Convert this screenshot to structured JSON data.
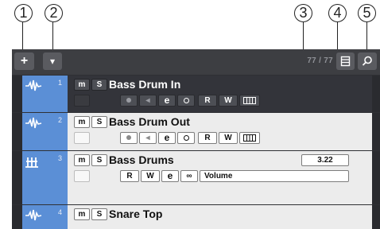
{
  "callouts": [
    "1",
    "2",
    "3",
    "4",
    "5"
  ],
  "toolbar": {
    "add_button": "+",
    "add_menu_button": "▾",
    "track_count": "77 / 77"
  },
  "icons": {
    "add_button": "plus-icon",
    "menu_button": "caret-down-icon",
    "visibility_button": "list-icon",
    "find_button": "search-icon",
    "audio_track": "audio-waveform-icon",
    "group_track": "group-folder-icon"
  },
  "colors": {
    "track_color": "#5b8fd6",
    "selected_row": "#33343a",
    "panel": "#2f3034"
  },
  "tracks": [
    {
      "number": "1",
      "name": "Bass Drum In",
      "selected": true,
      "mute": "m",
      "solo": "S",
      "read": "R",
      "write": "W"
    },
    {
      "number": "2",
      "name": "Bass Drum Out",
      "selected": false,
      "mute": "m",
      "solo": "S",
      "read": "R",
      "write": "W"
    },
    {
      "number": "3",
      "name": "Bass Drums",
      "selected": false,
      "mute": "m",
      "solo": "S",
      "read": "R",
      "write": "W",
      "value": "3.22",
      "parameter": "Volume"
    },
    {
      "number": "4",
      "name": "Snare Top",
      "selected": false,
      "mute": "m",
      "solo": "S"
    }
  ]
}
